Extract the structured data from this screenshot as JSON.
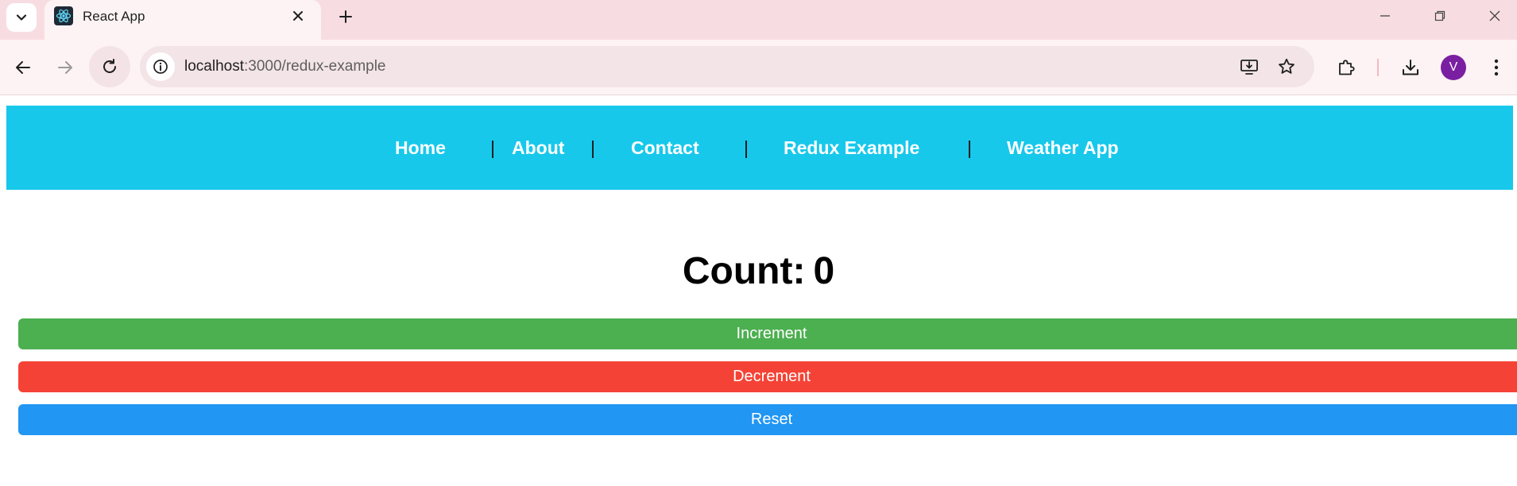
{
  "browser": {
    "tab_title": "React App",
    "url_host": "localhost",
    "url_rest": ":3000/redux-example",
    "profile_initial": "V"
  },
  "nav": {
    "links": [
      "Home",
      "About",
      "Contact",
      "Redux Example",
      "Weather App"
    ],
    "separator": "|"
  },
  "counter": {
    "label": "Count:",
    "value": "0"
  },
  "buttons": {
    "increment": "Increment",
    "decrement": "Decrement",
    "reset": "Reset"
  },
  "colors": {
    "nav_bg": "#17c8eb",
    "increment": "#4caf50",
    "decrement": "#f44336",
    "reset": "#2196f3"
  }
}
